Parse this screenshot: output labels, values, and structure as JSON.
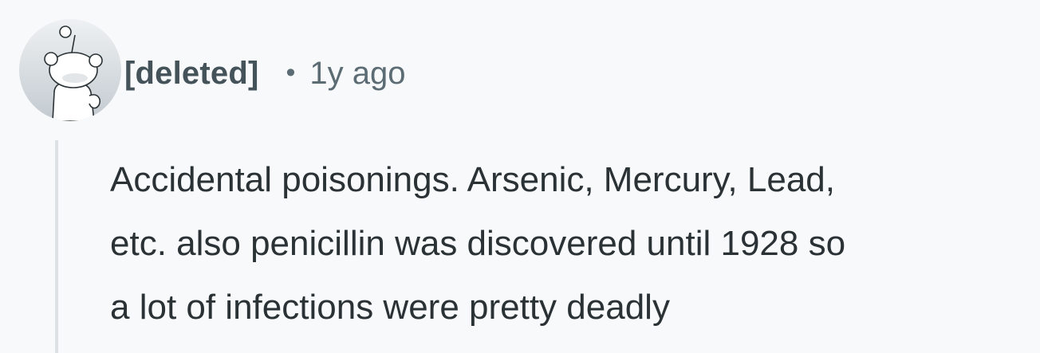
{
  "comment": {
    "author": "[deleted]",
    "separator": "•",
    "age": "1y ago",
    "body_lines": [
      "Accidental poisonings. Arsenic, Mercury, Lead,",
      "etc. also penicillin was discovered until 1928 so",
      "a lot of infections were pretty deadly"
    ]
  },
  "avatar": {
    "icon": "snoo-avatar-icon",
    "background_color": "#d3d9dd",
    "figure_color": "#ffffff"
  },
  "colors": {
    "page_background": "#f8f9fa",
    "text": "#2a3236",
    "meta_text": "#5c6c74",
    "thread_line": "#dde1e4"
  }
}
